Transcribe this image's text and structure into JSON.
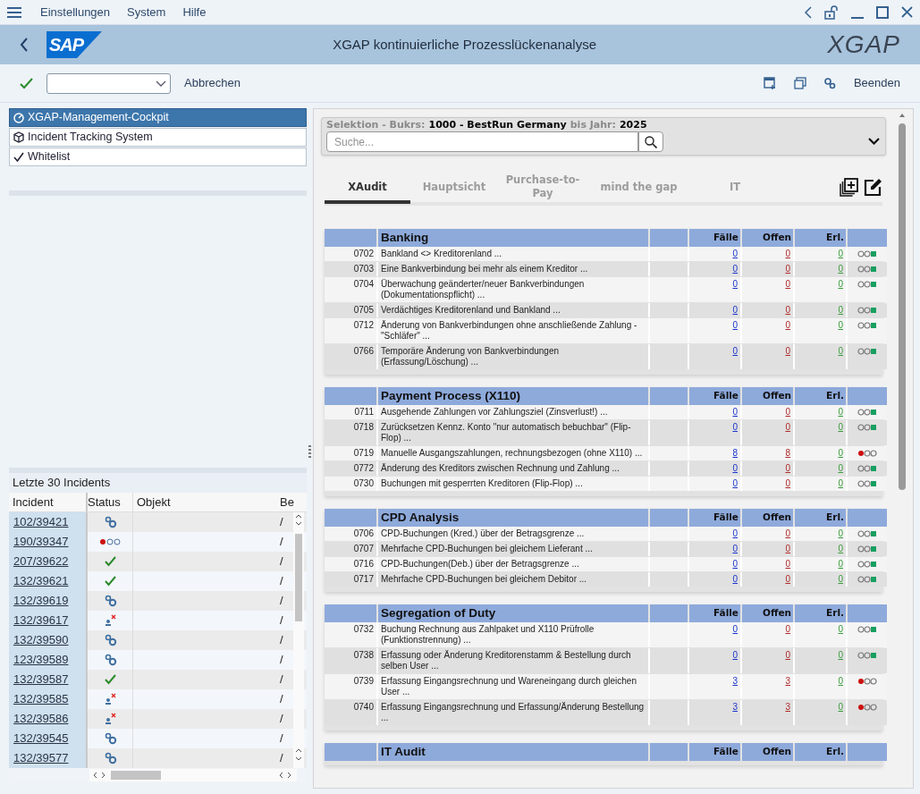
{
  "menu": [
    "Einstellungen",
    "System",
    "Hilfe"
  ],
  "titlebar": {
    "logo": "SAP",
    "title": "XGAP kontinuierliche Prozesslückenanalyse",
    "brand": "XGAP"
  },
  "toolbar": {
    "cancel": "Abbrechen",
    "exit": "Beenden"
  },
  "nav": [
    {
      "label": "XGAP-Management-Cockpit",
      "kind": "cockpit",
      "selected": true
    },
    {
      "label": "Incident Tracking System",
      "kind": "cube",
      "selected": false
    },
    {
      "label": "Whitelist",
      "kind": "check",
      "selected": false
    }
  ],
  "incidents": {
    "title": "Letzte 30 Incidents",
    "columns": [
      "Incident",
      "Status",
      "Objekt",
      "Be"
    ],
    "rows": [
      {
        "id": "102/39421",
        "kind": "gears",
        "column_4": "/"
      },
      {
        "id": "190/39347",
        "kind": "lights",
        "column_4": "/"
      },
      {
        "id": "207/39622",
        "kind": "check",
        "column_4": "/"
      },
      {
        "id": "132/39621",
        "kind": "check",
        "column_4": "/"
      },
      {
        "id": "132/39619",
        "kind": "gears",
        "column_4": "/"
      },
      {
        "id": "132/39617",
        "kind": "user",
        "column_4": "/"
      },
      {
        "id": "132/39590",
        "kind": "gears",
        "column_4": "/"
      },
      {
        "id": "123/39589",
        "kind": "gears",
        "column_4": "/"
      },
      {
        "id": "132/39587",
        "kind": "check",
        "column_4": "/"
      },
      {
        "id": "132/39585",
        "kind": "user",
        "column_4": "/"
      },
      {
        "id": "132/39586",
        "kind": "user",
        "column_4": "/"
      },
      {
        "id": "132/39545",
        "kind": "gears",
        "column_4": "/"
      },
      {
        "id": "132/39577",
        "kind": "gears",
        "column_4": "/"
      }
    ]
  },
  "selection": {
    "parts": [
      {
        "text": "Selektion - Bukrs:",
        "strong": false
      },
      {
        "text": "1000 - BestRun Germany",
        "strong": true
      },
      {
        "text": "bis Jahr:",
        "strong": false
      },
      {
        "text": "2025",
        "strong": true
      }
    ],
    "search_placeholder": "Suche..."
  },
  "tabs": [
    {
      "label": "XAudit",
      "selected": true
    },
    {
      "label": "Hauptsicht",
      "selected": false
    },
    {
      "label": "Purchase-to-Pay",
      "selected": false
    },
    {
      "label": "mind the gap",
      "selected": false
    },
    {
      "label": "IT",
      "selected": false
    }
  ],
  "sections": [
    {
      "title": "Banking",
      "columns": [
        "Fälle",
        "Offen",
        "Erl."
      ],
      "rows": [
        {
          "code": "0702",
          "text": "Bankland <> Kreditorenland ...",
          "cases": "0",
          "open": "0",
          "done": "0",
          "kind": "ok"
        },
        {
          "code": "0703",
          "text": "Eine Bankverbindung bei mehr als einem Kreditor ...",
          "cases": "0",
          "open": "0",
          "done": "0",
          "kind": "ok"
        },
        {
          "code": "0704",
          "text": "Überwachung geänderter/neuer Bankverbindungen (Dokumentationspflicht) ...",
          "cases": "0",
          "open": "0",
          "done": "0",
          "kind": "ok"
        },
        {
          "code": "0705",
          "text": "Verdächtiges Kreditorenland und Bankland ...",
          "cases": "0",
          "open": "0",
          "done": "0",
          "kind": "ok"
        },
        {
          "code": "0712",
          "text": "Änderung von Bankverbindungen ohne anschließende Zahlung - \"Schläfer\" ...",
          "cases": "0",
          "open": "0",
          "done": "0",
          "kind": "ok"
        },
        {
          "code": "0766",
          "text": "Temporäre Änderung von Bankverbindungen (Erfassung/Löschung) ...",
          "cases": "0",
          "open": "0",
          "done": "0",
          "kind": "ok"
        }
      ]
    },
    {
      "title": "Payment Process (X110)",
      "columns": [
        "Fälle",
        "Offen",
        "Erl."
      ],
      "rows": [
        {
          "code": "0711",
          "text": "Ausgehende Zahlungen vor Zahlungsziel (Zinsverlust!) ...",
          "cases": "0",
          "open": "0",
          "done": "0",
          "kind": "ok"
        },
        {
          "code": "0718",
          "text": "Zurücksetzen Kennz. Konto \"nur automatisch bebuchbar\" (Flip-Flop) ...",
          "cases": "0",
          "open": "0",
          "done": "0",
          "kind": "ok"
        },
        {
          "code": "0719",
          "text": "Manuelle Ausgangszahlungen, rechnungsbezogen (ohne X110) ...",
          "cases": "8",
          "open": "8",
          "done": "0",
          "kind": "alert"
        },
        {
          "code": "0772",
          "text": "Änderung des Kreditors zwischen Rechnung und Zahlung ...",
          "cases": "0",
          "open": "0",
          "done": "0",
          "kind": "ok"
        },
        {
          "code": "0730",
          "text": "Buchungen mit gesperrten Kreditoren (Flip-Flop) ...",
          "cases": "0",
          "open": "0",
          "done": "0",
          "kind": "ok"
        }
      ]
    },
    {
      "title": "CPD Analysis",
      "columns": [
        "Fälle",
        "Offen",
        "Erl."
      ],
      "rows": [
        {
          "code": "0706",
          "text": "CPD-Buchungen (Kred.) über der Betragsgrenze ...",
          "cases": "0",
          "open": "0",
          "done": "0",
          "kind": "ok"
        },
        {
          "code": "0707",
          "text": "Mehrfache CPD-Buchungen bei gleichem Lieferant ...",
          "cases": "0",
          "open": "0",
          "done": "0",
          "kind": "ok"
        },
        {
          "code": "0716",
          "text": "CPD-Buchungen(Deb.) über der Betragsgrenze ...",
          "cases": "0",
          "open": "0",
          "done": "0",
          "kind": "ok"
        },
        {
          "code": "0717",
          "text": "Mehrfache CPD-Buchungen bei gleichem Debitor ...",
          "cases": "0",
          "open": "0",
          "done": "0",
          "kind": "ok"
        }
      ]
    },
    {
      "title": "Segregation of Duty",
      "columns": [
        "Fälle",
        "Offen",
        "Erl."
      ],
      "rows": [
        {
          "code": "0732",
          "text": "Buchung Rechnung aus Zahlpaket und X110 Prüfrolle (Funktionstrennung) ...",
          "cases": "0",
          "open": "0",
          "done": "0",
          "kind": "ok"
        },
        {
          "code": "0738",
          "text": "Erfassung oder Änderung Kreditorenstamm & Bestellung durch selben User ...",
          "cases": "0",
          "open": "0",
          "done": "0",
          "kind": "ok"
        },
        {
          "code": "0739",
          "text": "Erfassung Eingangsrechnung und Wareneingang durch gleichen User ...",
          "cases": "3",
          "open": "3",
          "done": "0",
          "kind": "alert"
        },
        {
          "code": "0740",
          "text": "Erfassung Eingangsrechnung und Erfassung/Änderung Bestellung ...",
          "cases": "3",
          "open": "3",
          "done": "0",
          "kind": "alert"
        }
      ]
    },
    {
      "title": "IT Audit",
      "columns": [
        "Fälle",
        "Offen",
        "Erl."
      ]
    }
  ]
}
